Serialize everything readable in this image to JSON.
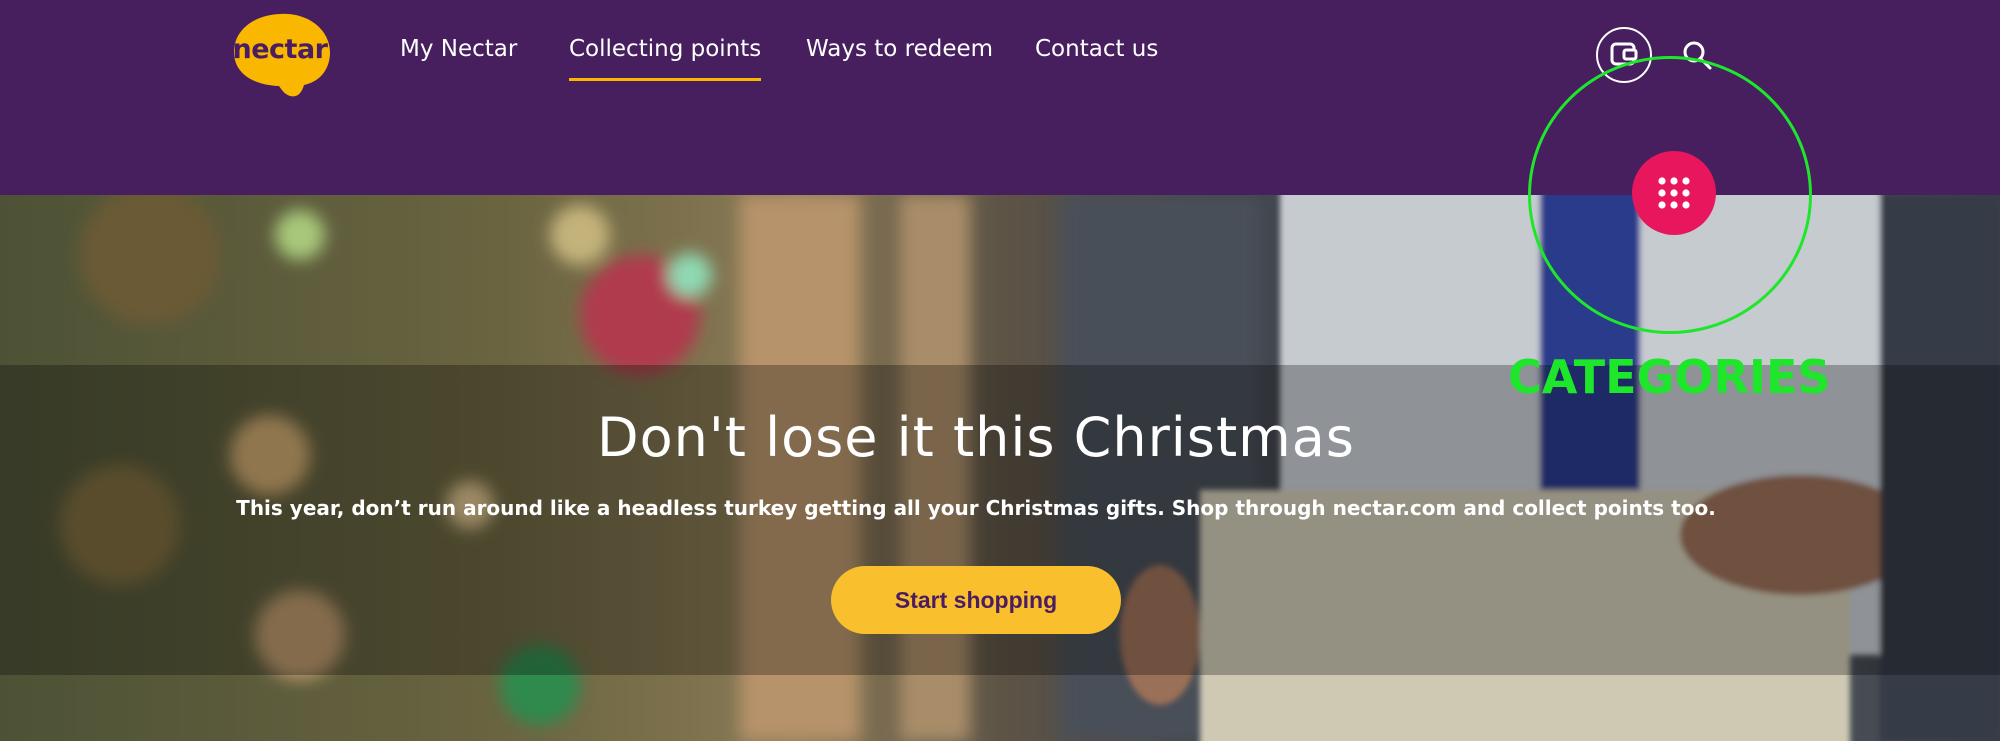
{
  "brand": {
    "logo_text": "nectar"
  },
  "nav": {
    "items": [
      {
        "label": "My Nectar",
        "active": false
      },
      {
        "label": "Collecting points",
        "active": true
      },
      {
        "label": "Ways to redeem",
        "active": false
      },
      {
        "label": "Contact us",
        "active": false
      }
    ]
  },
  "header_icons": {
    "wallet": "wallet-icon",
    "search": "search-icon"
  },
  "hero": {
    "headline": "Don't lose it this Christmas",
    "subtext": "This year, don’t run around like a headless turkey getting all your Christmas gifts. Shop through nectar.com and collect points too.",
    "cta_label": "Start shopping"
  },
  "categories_button": {
    "icon": "grid-dots-icon"
  },
  "annotation": {
    "label": "CATEGORIES"
  },
  "colors": {
    "header_bg": "#471f5f",
    "accent_yellow": "#f9bf2c",
    "underline": "#f9b700",
    "category_pink": "#e8175d",
    "annotation_green": "#1ee62a"
  }
}
